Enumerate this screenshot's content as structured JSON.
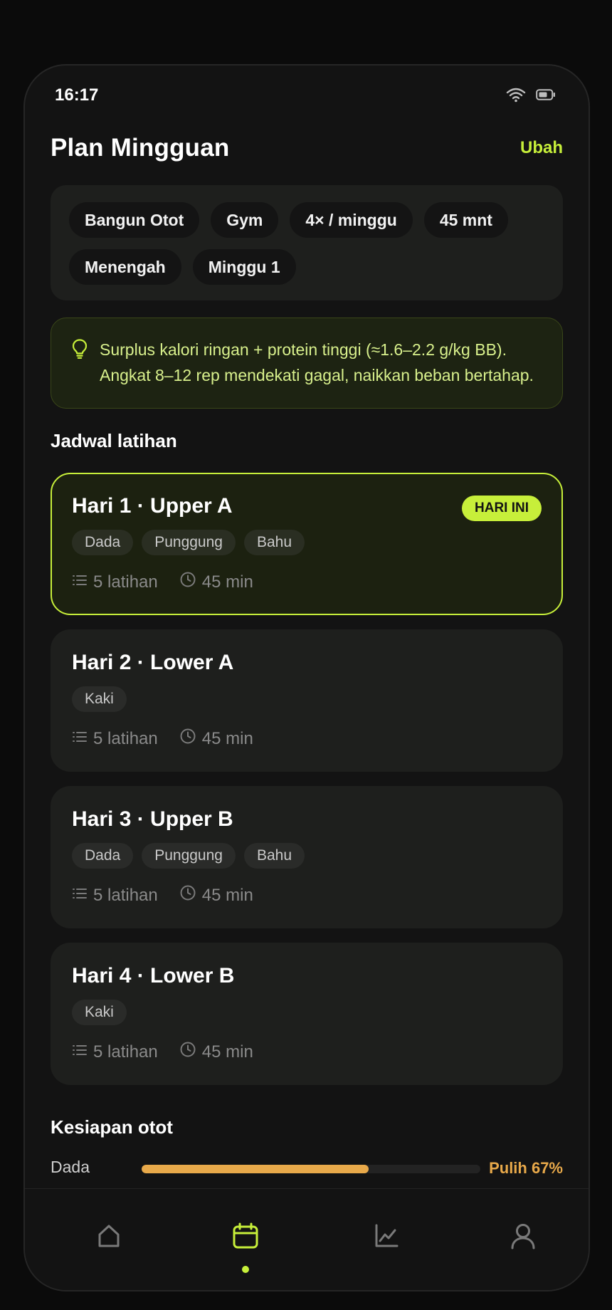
{
  "status": {
    "time": "16:17"
  },
  "header": {
    "title": "Plan Mingguan",
    "edit_label": "Ubah"
  },
  "summary_chips": [
    "Bangun Otot",
    "Gym",
    "4× / minggu",
    "45 mnt",
    "Menengah",
    "Minggu 1"
  ],
  "tip": {
    "text": "Surplus kalori ringan + protein tinggi (≈1.6–2.2 g/kg BB). Angkat 8–12 rep mendekati gagal, naikkan beban bertahap."
  },
  "schedule": {
    "title": "Jadwal latihan",
    "today_badge": "HARI INI",
    "days": [
      {
        "title": "Hari 1 · Upper A",
        "muscles": [
          "Dada",
          "Punggung",
          "Bahu"
        ],
        "exercises": "5 latihan",
        "duration": "45 min",
        "today": true
      },
      {
        "title": "Hari 2 · Lower A",
        "muscles": [
          "Kaki"
        ],
        "exercises": "5 latihan",
        "duration": "45 min",
        "today": false
      },
      {
        "title": "Hari 3 · Upper B",
        "muscles": [
          "Dada",
          "Punggung",
          "Bahu"
        ],
        "exercises": "5 latihan",
        "duration": "45 min",
        "today": false
      },
      {
        "title": "Hari 4 · Lower B",
        "muscles": [
          "Kaki"
        ],
        "exercises": "5 latihan",
        "duration": "45 min",
        "today": false
      }
    ]
  },
  "readiness": {
    "title": "Kesiapan otot",
    "items": [
      {
        "label": "Dada",
        "value_text": "Pulih 67%",
        "progress": 0.67,
        "color": "#e8a94a"
      }
    ]
  },
  "nav": {
    "items": [
      {
        "icon": "home-icon",
        "active": false
      },
      {
        "icon": "calendar-icon",
        "active": true
      },
      {
        "icon": "chart-icon",
        "active": false
      },
      {
        "icon": "profile-icon",
        "active": false
      }
    ]
  },
  "colors": {
    "accent": "#c7ef3a",
    "recovery": "#e8a94a",
    "background": "#131313",
    "card": "#1e1f1d"
  }
}
